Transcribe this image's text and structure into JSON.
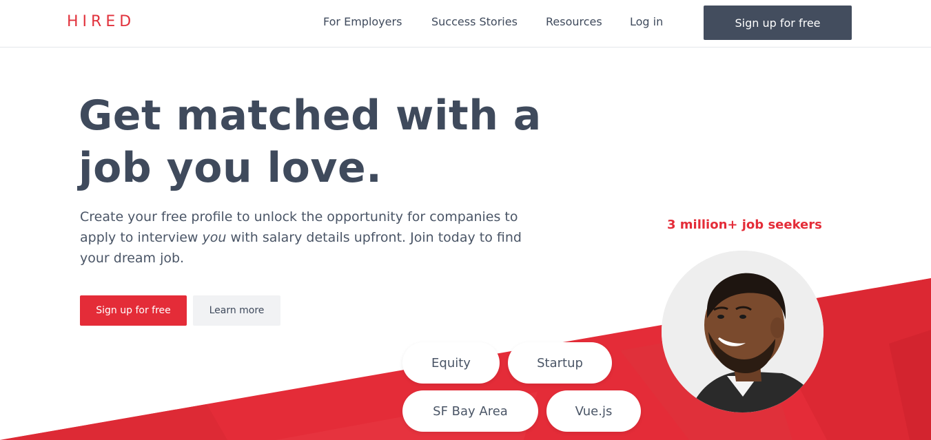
{
  "header": {
    "logo": "HIRED",
    "nav": [
      {
        "label": "For Employers"
      },
      {
        "label": "Success Stories"
      },
      {
        "label": "Resources"
      },
      {
        "label": "Log in"
      }
    ],
    "cta_label": "Sign up for free"
  },
  "hero": {
    "title_line1": "Get matched with a",
    "title_line2": "job you love.",
    "description_part1": "Create your free profile to unlock the opportunity for companies to apply to interview ",
    "description_emphasis": "you",
    "description_part2": " with salary details upfront. Join today to find your dream job.",
    "primary_button": "Sign up for free",
    "secondary_button": "Learn more",
    "stat": "3 million+ job seekers"
  },
  "tags": [
    {
      "label": "Equity"
    },
    {
      "label": "Startup"
    },
    {
      "label": "SF Bay Area"
    },
    {
      "label": "Vue.js"
    }
  ],
  "colors": {
    "brand_red": "#e42c38",
    "text_dark": "#3f4a5c",
    "header_button": "#434d5e"
  }
}
